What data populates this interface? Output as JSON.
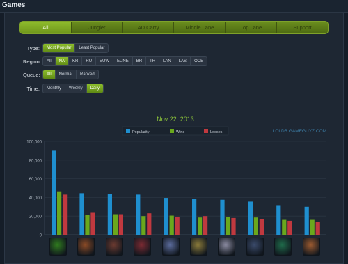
{
  "header": {
    "title": "Games"
  },
  "tabs": [
    "All",
    "Jungler",
    "AD Carry",
    "Middle Lane",
    "Top Lane",
    "Support"
  ],
  "filters": [
    {
      "label": "Type:",
      "options": [
        "Most Popular",
        "Least Popular"
      ],
      "active": 0
    },
    {
      "label": "Region:",
      "options": [
        "All",
        "NA",
        "KR",
        "RU",
        "EUW",
        "EUNE",
        "BR",
        "TR",
        "LAN",
        "LAS",
        "OCE"
      ],
      "active": 1
    },
    {
      "label": "Queue:",
      "options": [
        "All",
        "Normal",
        "Ranked"
      ],
      "active": 0
    },
    {
      "label": "Time:",
      "options": [
        "Monthly",
        "Weekly",
        "Daily"
      ],
      "active": 2
    }
  ],
  "chart_data": {
    "type": "bar",
    "title": "Nov 22. 2013",
    "watermark": "LOLDB.GAMEGUYZ.COM",
    "legend_position": "top-center",
    "ylim": [
      0,
      100000
    ],
    "yticks": [
      "0",
      "20,000",
      "40,000",
      "60,000",
      "80,000",
      "100,000"
    ],
    "grid": true,
    "categories_are_icons": true,
    "series": [
      {
        "name": "Popularity",
        "color": "#1f8fcf",
        "values": [
          90000,
          44500,
          44000,
          43000,
          39500,
          38500,
          37500,
          35500,
          31000,
          30000
        ]
      },
      {
        "name": "Wins",
        "color": "#6aa81d",
        "values": [
          46500,
          21000,
          22000,
          20000,
          20500,
          18500,
          19000,
          18500,
          16000,
          16000
        ]
      },
      {
        "name": "Losses",
        "color": "#c0393f",
        "values": [
          43000,
          23500,
          22000,
          23000,
          19000,
          20000,
          18000,
          17000,
          15000,
          14000
        ]
      }
    ]
  },
  "hero_icons": [
    {
      "name": "zac-icon",
      "color": "#2f7a1e"
    },
    {
      "name": "tryndamere-icon",
      "color": "#8a4a26"
    },
    {
      "name": "caitlyn-icon",
      "color": "#6b3a30"
    },
    {
      "name": "katarina-icon",
      "color": "#7a2a32"
    },
    {
      "name": "jinx-icon",
      "color": "#5a6a9a"
    },
    {
      "name": "nasus-icon",
      "color": "#8a7a3a"
    },
    {
      "name": "janna-icon",
      "color": "#8a8aa0"
    },
    {
      "name": "vayne-icon",
      "color": "#3a4a6a"
    },
    {
      "name": "thresh-icon",
      "color": "#1f6a4a"
    },
    {
      "name": "teemo-icon",
      "color": "#9a5a30"
    }
  ]
}
